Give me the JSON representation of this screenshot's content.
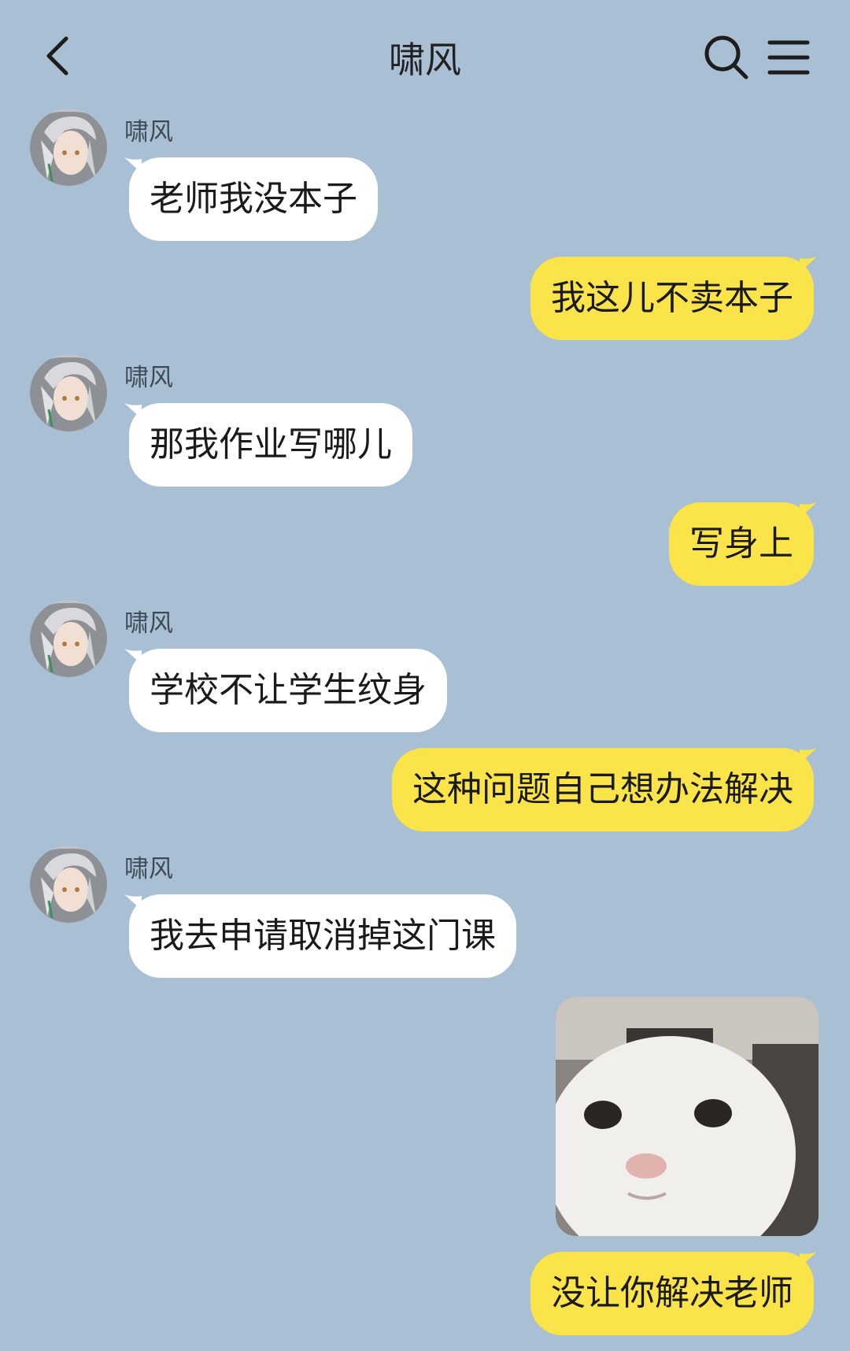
{
  "header": {
    "title": "啸风",
    "back_icon": "chevron-left-icon",
    "search_icon": "search-icon",
    "menu_icon": "hamburger-menu-icon"
  },
  "messages": [
    {
      "side": "left",
      "sender": "啸风",
      "text": "老师我没本子"
    },
    {
      "side": "right",
      "text": "我这儿不卖本子"
    },
    {
      "side": "left",
      "sender": "啸风",
      "text": "那我作业写哪儿"
    },
    {
      "side": "right",
      "text": "写身上"
    },
    {
      "side": "left",
      "sender": "啸风",
      "text": "学校不让学生纹身"
    },
    {
      "side": "right",
      "text": "这种问题自己想办法解决"
    },
    {
      "side": "left",
      "sender": "啸风",
      "text": "我去申请取消掉这门课"
    },
    {
      "side": "right",
      "type": "sticker",
      "sticker": "white-cat-face-sticker"
    },
    {
      "side": "right",
      "text": "没让你解决老师"
    }
  ],
  "colors": {
    "background": "#a9bfd3",
    "incoming_bubble": "#ffffff",
    "outgoing_bubble": "#fbe34a"
  }
}
